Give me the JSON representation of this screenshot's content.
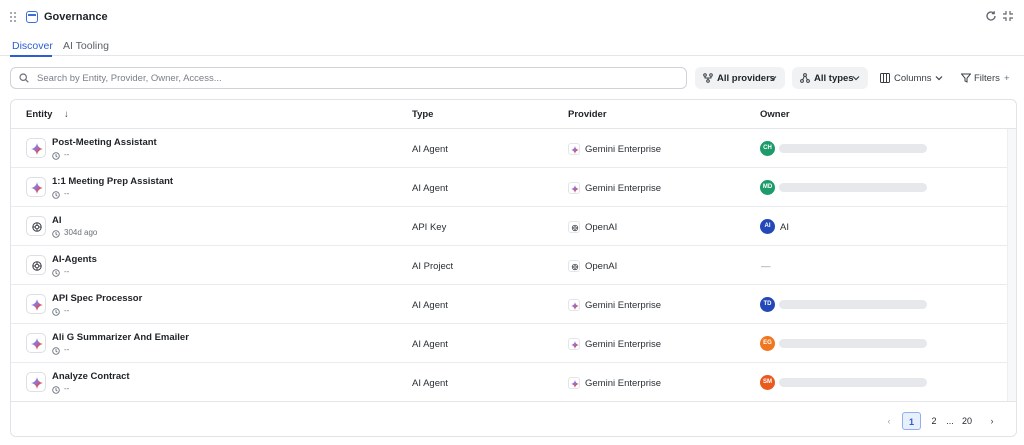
{
  "header": {
    "title": "Governance",
    "icons": [
      "drag-handle-icon",
      "app-icon",
      "refresh-icon",
      "collapse-icon"
    ]
  },
  "tabs": [
    {
      "label": "Discover",
      "active": true
    },
    {
      "label": "AI Tooling",
      "active": false
    }
  ],
  "search": {
    "placeholder": "Search by Entity, Provider, Owner, Access...",
    "value": ""
  },
  "filters": {
    "providers_label": "All providers",
    "types_label": "All types",
    "columns_label": "Columns",
    "filters_label": "Filters",
    "filters_suffix": "+"
  },
  "table": {
    "columns": {
      "entity": "Entity",
      "sort_indicator": "↓",
      "type": "Type",
      "provider": "Provider",
      "owner": "Owner"
    },
    "rows": [
      {
        "name": "Post-Meeting Assistant",
        "sub": "--",
        "type": "AI Agent",
        "provider": "Gemini Enterprise",
        "provider_icon": "gemini-icon",
        "owner_initials": "CH",
        "owner_color": "#1e9b6b",
        "owner_name": ""
      },
      {
        "name": "1:1 Meeting Prep Assistant",
        "sub": "--",
        "type": "AI Agent",
        "provider": "Gemini Enterprise",
        "provider_icon": "gemini-icon",
        "owner_initials": "MD",
        "owner_color": "#1e9b6b",
        "owner_name": ""
      },
      {
        "name": "AI",
        "sub": "304d ago",
        "type": "API Key",
        "provider": "OpenAI",
        "provider_icon": "openai-icon",
        "owner_initials": "AI",
        "owner_color": "#2448b8",
        "owner_name": "AI"
      },
      {
        "name": "AI-Agents",
        "sub": "--",
        "type": "AI Project",
        "provider": "OpenAI",
        "provider_icon": "openai-icon",
        "owner_initials": "",
        "owner_color": "",
        "owner_name": "—"
      },
      {
        "name": "API Spec Processor",
        "sub": "--",
        "type": "AI Agent",
        "provider": "Gemini Enterprise",
        "provider_icon": "gemini-icon",
        "owner_initials": "TD",
        "owner_color": "#2448b8",
        "owner_name": ""
      },
      {
        "name": "Ali G Summarizer And Emailer",
        "sub": "--",
        "type": "AI Agent",
        "provider": "Gemini Enterprise",
        "provider_icon": "gemini-icon",
        "owner_initials": "EG",
        "owner_color": "#f0761f",
        "owner_name": ""
      },
      {
        "name": "Analyze Contract",
        "sub": "--",
        "type": "AI Agent",
        "provider": "Gemini Enterprise",
        "provider_icon": "gemini-icon",
        "owner_initials": "SM",
        "owner_color": "#ea5a1f",
        "owner_name": ""
      }
    ]
  },
  "pagination": {
    "prev": "‹",
    "pages": [
      "1",
      "2",
      "...",
      "20"
    ],
    "current": "1",
    "next": "›"
  }
}
